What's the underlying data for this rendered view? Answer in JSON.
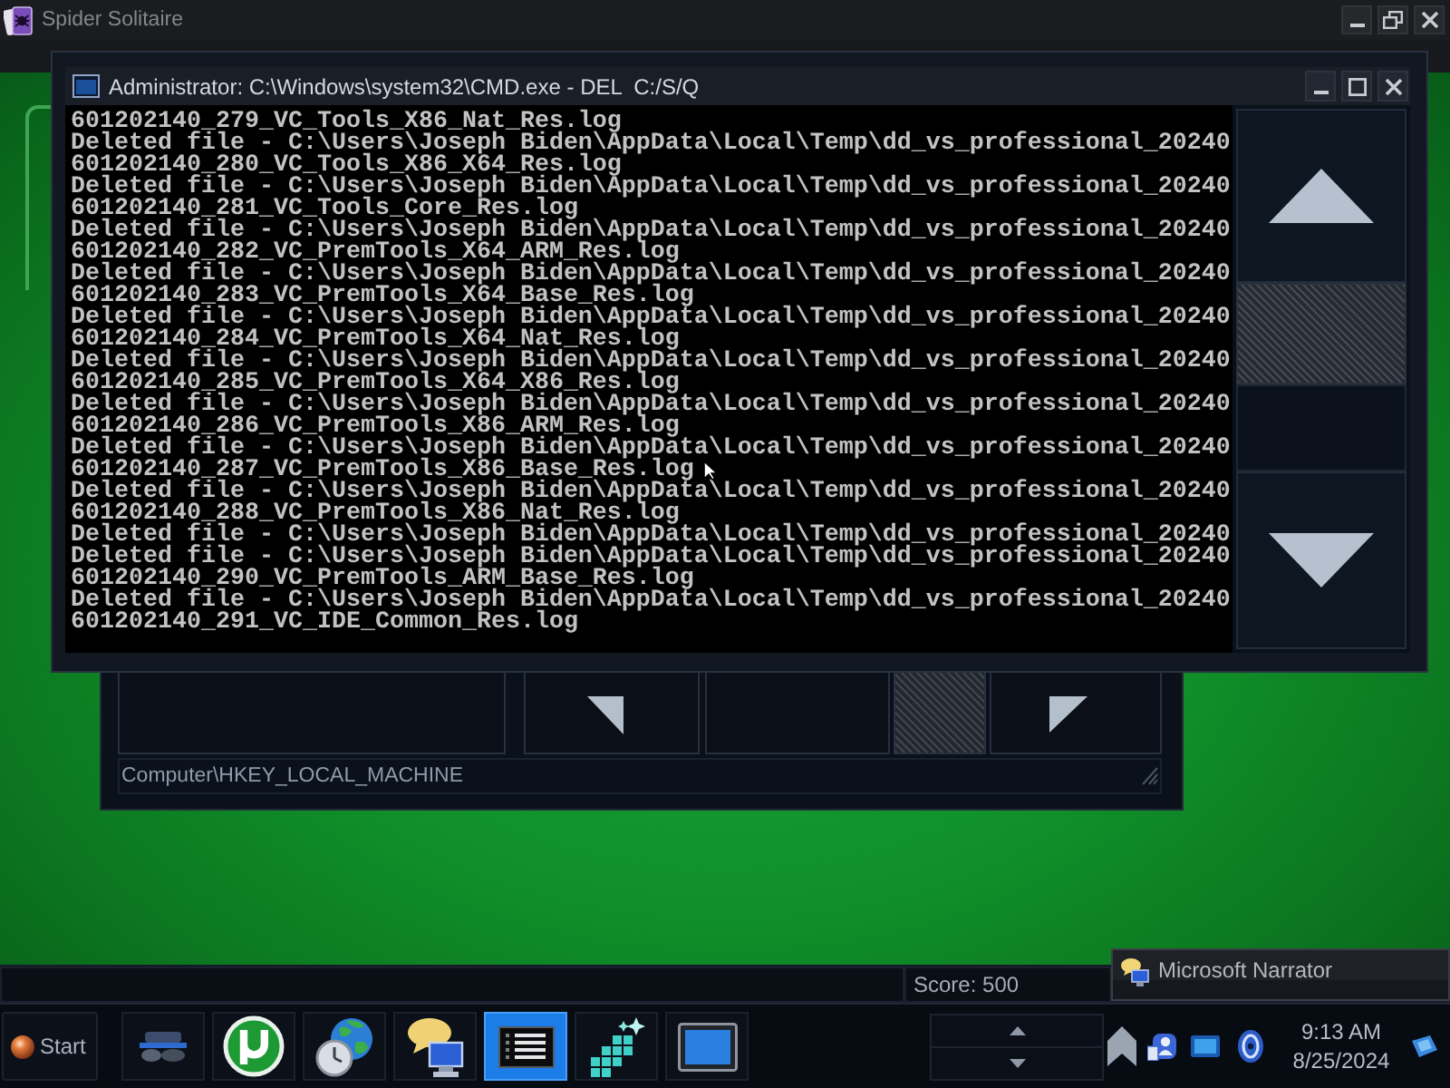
{
  "game_window": {
    "title": "Spider Solitaire",
    "status_bar": {
      "score": "Score: 500"
    }
  },
  "console_window": {
    "title": "Administrator: C:\\Windows\\system32\\CMD.exe - DEL  C:/S/Q",
    "lines": [
      "601202140_279_VC_Tools_X86_Nat_Res.log",
      "Deleted file - C:\\Users\\Joseph Biden\\AppData\\Local\\Temp\\dd_vs_professional_20240",
      "601202140_280_VC_Tools_X86_X64_Res.log",
      "Deleted file - C:\\Users\\Joseph Biden\\AppData\\Local\\Temp\\dd_vs_professional_20240",
      "601202140_281_VC_Tools_Core_Res.log",
      "Deleted file - C:\\Users\\Joseph Biden\\AppData\\Local\\Temp\\dd_vs_professional_20240",
      "601202140_282_VC_PremTools_X64_ARM_Res.log",
      "Deleted file - C:\\Users\\Joseph Biden\\AppData\\Local\\Temp\\dd_vs_professional_20240",
      "601202140_283_VC_PremTools_X64_Base_Res.log",
      "Deleted file - C:\\Users\\Joseph Biden\\AppData\\Local\\Temp\\dd_vs_professional_20240",
      "601202140_284_VC_PremTools_X64_Nat_Res.log",
      "Deleted file - C:\\Users\\Joseph Biden\\AppData\\Local\\Temp\\dd_vs_professional_20240",
      "601202140_285_VC_PremTools_X64_X86_Res.log",
      "Deleted file - C:\\Users\\Joseph Biden\\AppData\\Local\\Temp\\dd_vs_professional_20240",
      "601202140_286_VC_PremTools_X86_ARM_Res.log",
      "Deleted file - C:\\Users\\Joseph Biden\\AppData\\Local\\Temp\\dd_vs_professional_20240",
      "601202140_287_VC_PremTools_X86_Base_Res.log",
      "Deleted file - C:\\Users\\Joseph Biden\\AppData\\Local\\Temp\\dd_vs_professional_20240",
      "601202140_288_VC_PremTools_X86_Nat_Res.log",
      "Deleted file - C:\\Users\\Joseph Biden\\AppData\\Local\\Temp\\dd_vs_professional_20240",
      "Deleted file - C:\\Users\\Joseph Biden\\AppData\\Local\\Temp\\dd_vs_professional_20240",
      "601202140_290_VC_PremTools_ARM_Base_Res.log",
      "Deleted file - C:\\Users\\Joseph Biden\\AppData\\Local\\Temp\\dd_vs_professional_20240",
      "601202140_291_VC_IDE_Common_Res.log"
    ]
  },
  "registry_window": {
    "status_bar": "Computer\\HKEY_LOCAL_MACHINE"
  },
  "narrator_preview": {
    "title": "Microsoft Narrator"
  },
  "taskbar": {
    "start": "Start",
    "buttons": [
      {
        "kind": "screens",
        "selected": false
      },
      {
        "kind": "disc",
        "selected": false
      },
      {
        "kind": "globe",
        "selected": false
      },
      {
        "kind": "chat",
        "selected": false
      },
      {
        "kind": "list",
        "selected": true
      },
      {
        "kind": "cubes",
        "selected": false
      },
      {
        "kind": "monitor",
        "selected": false
      }
    ],
    "clock": {
      "time": "9:13 AM",
      "date": "8/25/2024"
    }
  }
}
